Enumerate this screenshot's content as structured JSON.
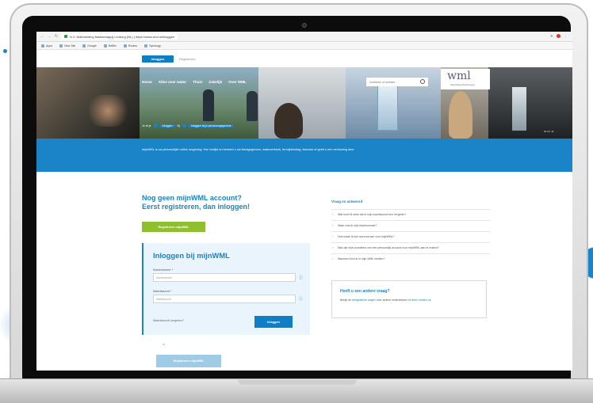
{
  "browser": {
    "url_text": "N.V. Waterleiding Maatschappij Limburg (NL) | https://www.wml.nl/inloggen",
    "bookmarks": [
      "Apps",
      "New Tab",
      "Google",
      "Netflix",
      "Routes",
      "Synology"
    ]
  },
  "site": {
    "topbar": {
      "login_tab": "Inloggen",
      "register_tab": "Registreren"
    },
    "hero": {
      "nav": [
        "Home",
        "Alles over water",
        "Thuis",
        "Zakelijk",
        "Over WML"
      ],
      "search_placeholder": "Zoekterm of website",
      "logo": "wml",
      "logo_sub": "Waterleiding Maatschappij",
      "caption_pre": "Je zit je",
      "caption_pill": "Inloggen",
      "caption_mid": "bij",
      "caption_tail": "Inloggen bij je persoonsgegevens",
      "corner": "BLOG JE"
    },
    "banner_text": "mijnWML is uw persoonlijke online omgeving. Hier bekijkt en beheert u uw klantgegevens, waterverbruik, termijnbedrag, facturen of geeft u een verhuizing door."
  },
  "promo": {
    "title_line1": "Nog geen mijnWML account?",
    "title_line2": "Eerst registreren, dan inloggen!",
    "register_button": "Registreren mijnWML"
  },
  "login": {
    "title": "Inloggen bij mijnWML",
    "customer_label": "Klantnummer *",
    "customer_placeholder": "Klantnummer",
    "password_label": "Wachtwoord *",
    "password_placeholder": "Wachtwoord",
    "forgot_link": "Wachtwoord vergeten?",
    "submit_button": "Inloggen",
    "register_button_bottom": "Registreren mijnWML"
  },
  "faq": {
    "title": "Vraag en antwoord",
    "items": [
      "Wat moet ik doen als ik mijn wachtwoord ben vergeten?",
      "Waar vind ik mijn klantnummer?",
      "Hoe maak ik een account aan voor mijnWML?",
      "Wat zijn mijn voordelen van een persoonlijk account voor mijnWML aan te maken?",
      "Wanneer kom ik in mijn WML werken?"
    ]
  },
  "other": {
    "title": "Heeft u een andere vraag?",
    "text_pre": "Bekijk de",
    "text_link1": "veelgestelde vragen",
    "text_mid": "over andere onderwerpen of",
    "text_link2": "neem contact op."
  },
  "colors": {
    "brand_blue": "#1a84c8",
    "green": "#8fbe2e",
    "card_bg": "#e9f4fc"
  }
}
